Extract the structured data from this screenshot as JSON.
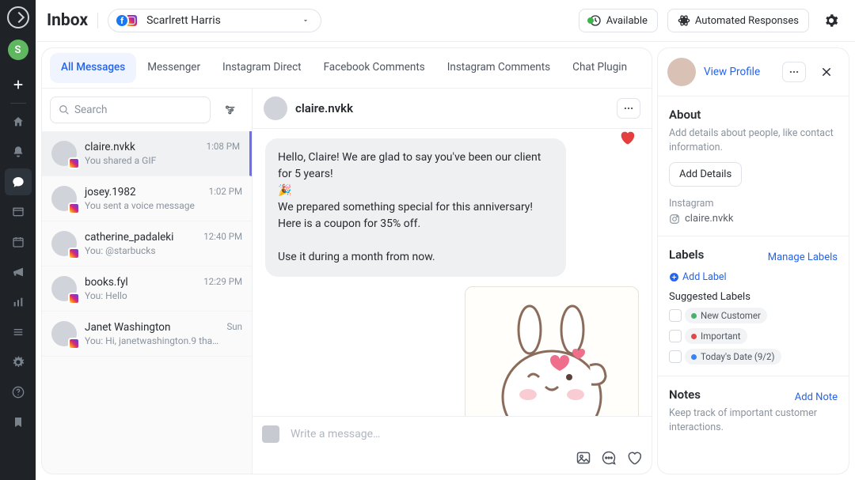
{
  "rail": {
    "avatar_letter": "S"
  },
  "topbar": {
    "title": "Inbox",
    "account_name": "Scarlrett Harris",
    "available_label": "Available",
    "automated_label": "Automated Responses"
  },
  "tabs": [
    {
      "label": "All Messages",
      "active": true
    },
    {
      "label": "Messenger",
      "active": false
    },
    {
      "label": "Instagram Direct",
      "active": false
    },
    {
      "label": "Facebook Comments",
      "active": false
    },
    {
      "label": "Instagram Comments",
      "active": false
    },
    {
      "label": "Chat Plugin",
      "active": false
    }
  ],
  "search": {
    "placeholder": "Search"
  },
  "threads": [
    {
      "name": "claire.nvkk",
      "preview": "You shared a GIF",
      "time": "1:08 PM",
      "active": true
    },
    {
      "name": "josey.1982",
      "preview": "You sent a voice message",
      "time": "1:02 PM",
      "active": false
    },
    {
      "name": "catherine_padaleki",
      "preview": "You: @starbucks",
      "time": "12:40 PM",
      "active": false
    },
    {
      "name": "books.fyl",
      "preview": "You: Hello",
      "time": "12:29 PM",
      "active": false
    },
    {
      "name": "Janet Washington",
      "preview": "You: Hi, janetwashington.9 thanks for…",
      "time": "Sun",
      "active": false
    }
  ],
  "conversation": {
    "name": "claire.nvkk",
    "messages": [
      {
        "from": "me",
        "text_lines": [
          "Hello, Claire! We are glad to say you've been our client for 5 years!",
          "🎉",
          "We prepared something special for this anniversary! Here is a coupon for 35% off.",
          "",
          "Use it during a month from now."
        ]
      }
    ],
    "composer_placeholder": "Write a message…"
  },
  "side_panel": {
    "view_profile": "View Profile",
    "about": {
      "title": "About",
      "text": "Add details about people, like contact information.",
      "button": "Add Details",
      "instagram_label": "Instagram",
      "instagram_handle": "claire.nvkk"
    },
    "labels": {
      "title": "Labels",
      "manage": "Manage Labels",
      "add_label": "Add Label",
      "suggested_title": "Suggested Labels",
      "suggestions": [
        {
          "text": "New Customer",
          "color": "#45b26b"
        },
        {
          "text": "Important",
          "color": "#e24848"
        },
        {
          "text": "Today's Date (9/2)",
          "color": "#3b82f6"
        }
      ]
    },
    "notes": {
      "title": "Notes",
      "add": "Add Note",
      "text": "Keep track of important customer interactions."
    }
  }
}
